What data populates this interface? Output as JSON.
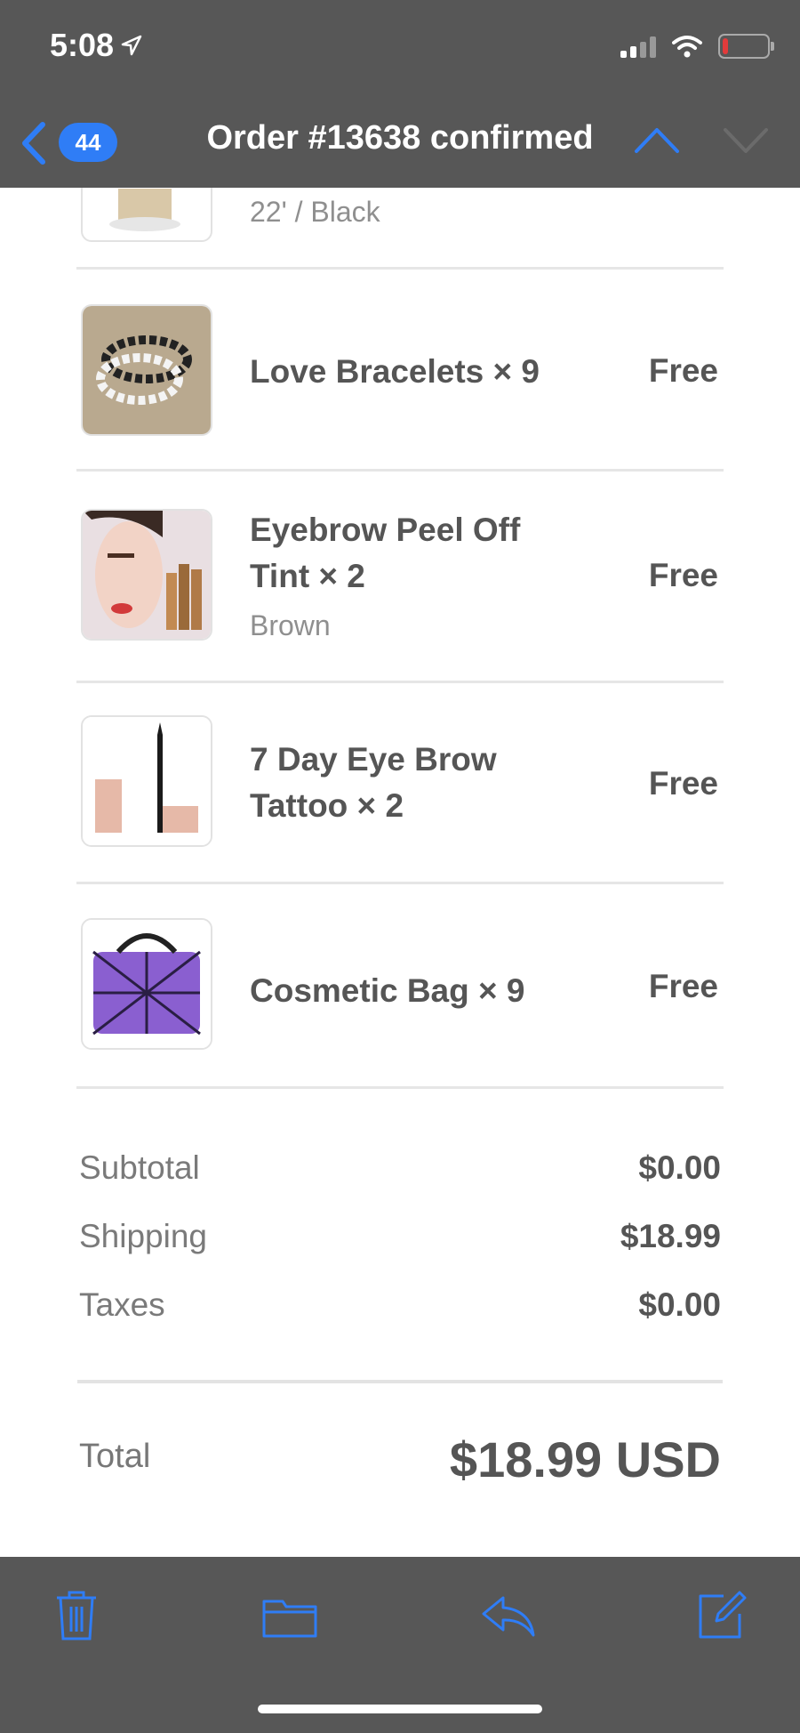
{
  "status": {
    "time": "5:08"
  },
  "nav": {
    "badge": "44",
    "title": "Order #13638 confirmed"
  },
  "items": [
    {
      "name": "",
      "variant": "22' / Black",
      "price": ""
    },
    {
      "name": "Love Bracelets × 9",
      "variant": "",
      "price": "Free"
    },
    {
      "name_line1": "Eyebrow Peel Off",
      "name_line2": "Tint × 2",
      "variant": "Brown",
      "price": "Free"
    },
    {
      "name_line1": "7 Day Eye Brow",
      "name_line2": "Tattoo × 2",
      "variant": "",
      "price": "Free"
    },
    {
      "name": "Cosmetic Bag × 9",
      "variant": "",
      "price": "Free"
    }
  ],
  "summary": {
    "subtotal_label": "Subtotal",
    "subtotal": "$0.00",
    "shipping_label": "Shipping",
    "shipping": "$18.99",
    "taxes_label": "Taxes",
    "taxes": "$0.00",
    "total_label": "Total",
    "total": "$18.99 USD"
  },
  "colors": {
    "accent": "#2f7df6",
    "bar": "#575757"
  },
  "toolbar": {
    "icons": [
      "trash-icon",
      "folder-icon",
      "reply-icon",
      "compose-icon"
    ]
  }
}
